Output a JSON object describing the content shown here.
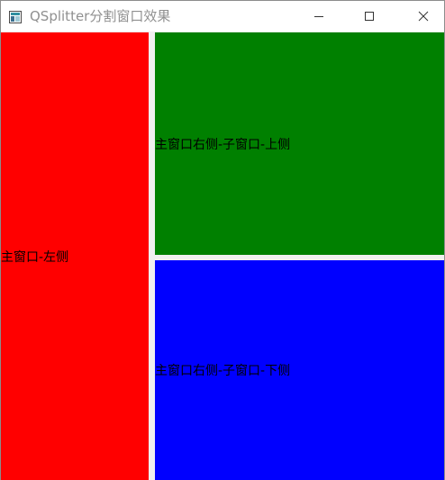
{
  "window": {
    "title": "QSplitter分割窗口效果",
    "icons": {
      "app": "qt-window-icon",
      "minimize": "minimize-icon",
      "maximize": "maximize-icon",
      "close": "close-icon"
    }
  },
  "splitter": {
    "left": {
      "label": "主窗口-左侧",
      "color": "#ff0000"
    },
    "right_top": {
      "label": "主窗口右侧-子窗口-上侧",
      "color": "#008000"
    },
    "right_bottom": {
      "label": "主窗口右侧-子窗口-下侧",
      "color": "#0000ff"
    }
  }
}
